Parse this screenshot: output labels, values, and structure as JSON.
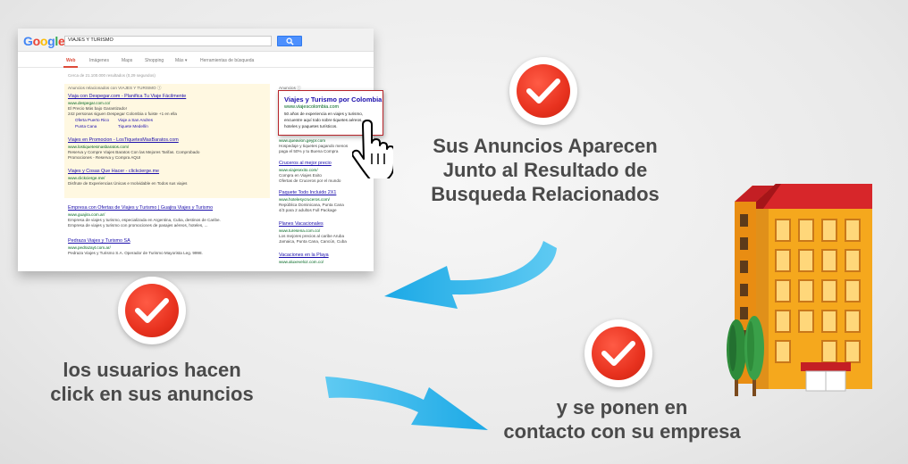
{
  "serp": {
    "logo": [
      "G",
      "o",
      "o",
      "g",
      "l",
      "e"
    ],
    "logo_colors": [
      "#4285f4",
      "#ea4335",
      "#fbbc05",
      "#4285f4",
      "#34a853",
      "#ea4335"
    ],
    "query": "VIAJES Y TURISMO",
    "tabs": [
      "Web",
      "Imágenes",
      "Maps",
      "Shopping",
      "Más ▾",
      "Herramientas de búsqueda"
    ],
    "stats": "Cerca de 21.100.000 resultados (0,29 segundos)",
    "ads_header": "Anuncios relacionados con VIAJES Y TURISMO ⓘ",
    "ads": [
      {
        "title": "Viaja con Despegar.com - Planifica Tu Viaje Fácilmente",
        "url": "www.despegar.com.co/",
        "lines": [
          "El Precio Más bajo Garantizado!",
          "242 personas siguen Despegar Colombia o fuiste +1 en ella"
        ],
        "sitelinks": [
          "Oferta Puerto Rico",
          "Viaje a San Andres",
          "Punta Cana",
          "Tiquete Medellín"
        ]
      },
      {
        "title": "Viajes en Promocion - LosTiquetesMasBaratos.com",
        "url": "www.lostiquetesmasbaratos.com/",
        "lines": [
          "Reserva y Compre Viajes Baratos Con las Mejores Tarifas. Comprobado",
          "Promociones - Reserva y Compra AQUI"
        ]
      },
      {
        "title": "Viajes y Cosas Que Hacer - clickcierge.me",
        "url": "www.clickcierge.me/",
        "lines": [
          "Disfrute de Experiencias Únicas e Inolvidable en Todos sus viajes"
        ]
      }
    ],
    "organic": [
      {
        "title": "Empresa con Ofertas de Viajes y Turismo | Guajira Viajes y Turismo",
        "url": "www.guajira.com.ar/",
        "lines": [
          "Empresa de viajes y turismo, especializada en Argentina, Cuba, destinos de Caribe.",
          "Empresa de viajes y turismo con promociones de pasajes aéreos, hoteles, ..."
        ]
      },
      {
        "title": "Pedraza Viajes y Turismo SA",
        "url": "www.pedrazayt.com.ar/",
        "lines": [
          "Pedraza Viajes y Turismo S.A. Operador de Turismo Mayorista Leg. 9998."
        ]
      }
    ],
    "side_header": "Anuncios ⓘ",
    "side_ads": [
      {
        "title": "",
        "url": "www.queavion.geypr.com",
        "lines": [
          "Hospedaje y tiquetes pagando menos",
          "paga el 50% y tu Buena Compra"
        ]
      },
      {
        "title": "Cruceros al mejor precio",
        "url": "www.viajesexito.com/",
        "lines": [
          "Compra en Viajes Exito",
          "Ofertas de Cruceros por el mundo"
        ]
      },
      {
        "title": "Paquete Todo Incluido 2X1",
        "url": "www.hotelesycruceros.com/",
        "lines": [
          "República Dominicana, Punta Cana",
          "4/3 para 2 adultos Full Package"
        ]
      },
      {
        "title": "Planes Vacacionales",
        "url": "www.turesena.com.co/",
        "lines": [
          "Los mejores precios al caribe Aruba",
          "Jamaica, Punta Cana, Cancún, Cuba"
        ]
      },
      {
        "title": "Vacaciones en la Playa",
        "url": "www.aluxeveloz.com.co/",
        "lines": []
      }
    ],
    "featured_ad": {
      "title": "Viajes y Turismo por Colombia",
      "url": "www.viajescolombia.com",
      "lines": [
        "50 años de experiencia en viajes y turismo,",
        "encuentre aquí todo sobre tiquetes aéreos,",
        "hoteles y paquetes turísticos."
      ]
    }
  },
  "captions": {
    "top_right": [
      "Sus Anuncios Aparecen",
      "Junto al Resultado de",
      "Busqueda Relacionados"
    ],
    "left": [
      "los usuarios hacen",
      "click en sus anuncios"
    ],
    "bottom_right": [
      "y se ponen en",
      "contacto con su empresa"
    ]
  },
  "colors": {
    "badge_red": "#e8321f",
    "arrow_blue": "#22aee8",
    "caption_text": "#4a4a4a",
    "building_orange": "#f4a21a",
    "building_roof": "#d7262a",
    "tree_green": "#2e8b3a"
  },
  "icons": [
    "checkmark-icon",
    "hand-pointer-icon",
    "curved-arrow-icon",
    "building-icon",
    "tree-icon",
    "search-icon"
  ]
}
